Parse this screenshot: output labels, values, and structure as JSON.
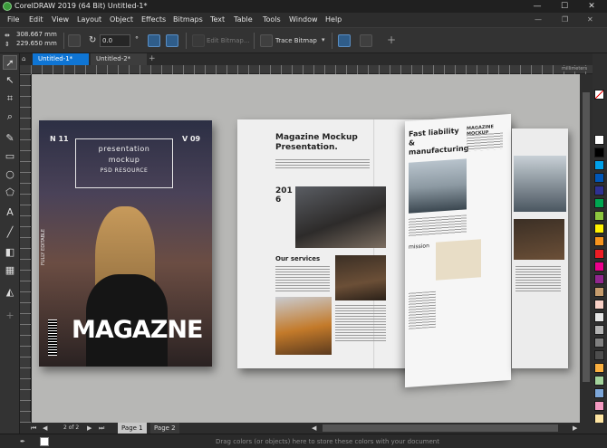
{
  "window": {
    "title": "CorelDRAW 2019 (64 Bit)  Untitled-1*"
  },
  "menu": [
    "File",
    "Edit",
    "View",
    "Layout",
    "Object",
    "Effects",
    "Bitmaps",
    "Text",
    "Table",
    "Tools",
    "Window",
    "Help"
  ],
  "propbar": {
    "x": "308.667 mm",
    "y": "229.650 mm",
    "rotation": "0.0",
    "edit_bitmap": "Edit Bitmap...",
    "trace_bitmap": "Trace Bitmap"
  },
  "tabs": [
    "Untitled-1*",
    "Untitled-2*"
  ],
  "ruler_unit": "millimeters",
  "pages": [
    "Page 1",
    "Page 2"
  ],
  "status": "Drag colors (or objects) here to store these colors with your document",
  "canvas": {
    "cover": {
      "box": [
        "presentation",
        "mockup",
        "PSD RESOURCE"
      ],
      "title": "MAGAZNE",
      "num_left": "N 11",
      "num_right": "V 09",
      "side_text": "FULLY EDITABLE"
    },
    "spread": {
      "title": "Magazine Mockup Presentation.",
      "year": "2016",
      "services": "Our services",
      "curl_heading": "Fast liability & manufacturing",
      "curl_sub": "MAGAZINE MOCKUP",
      "mission": "mission"
    }
  },
  "palette": [
    "#ffffff",
    "#000000",
    "#00a0e9",
    "#0057b8",
    "#2e3192",
    "#00a651",
    "#8dc63f",
    "#fff200",
    "#f7941d",
    "#ed1c24",
    "#ec008c",
    "#92278f",
    "#c69c6d",
    "#f9d1c7",
    "#e6e6e6",
    "#b3b3b3",
    "#808080",
    "#4d4d4d",
    "#fbb040",
    "#a3d39c",
    "#7da7d9",
    "#f49ac1",
    "#ffe6a3",
    "#d2e8c2"
  ]
}
